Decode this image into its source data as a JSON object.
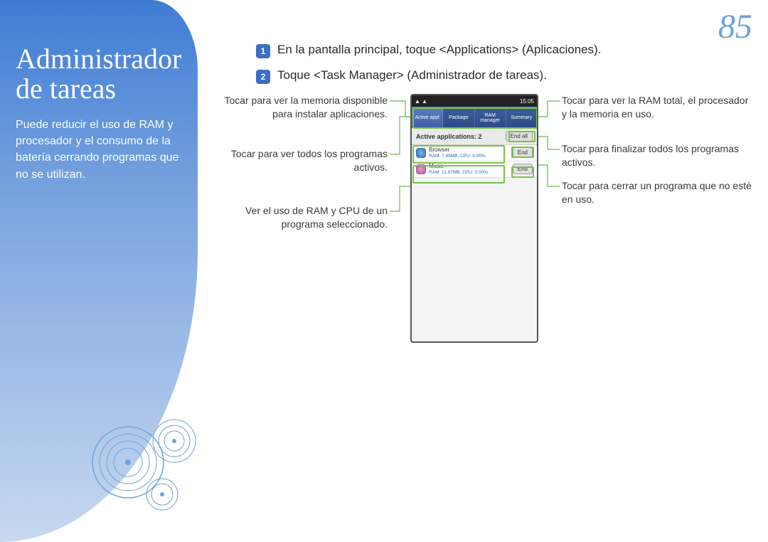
{
  "page_number": "85",
  "sidebar": {
    "title_line1": "Administrador",
    "title_line2": "de tareas",
    "description": "Puede reducir el uso de RAM y procesador y el consumo de la batería cerrando programas que no se utilizan."
  },
  "steps": [
    {
      "num": "1",
      "text": "En la pantalla principal, toque <Applications> (Aplicaciones)."
    },
    {
      "num": "2",
      "text": "Toque <Task Manager> (Administrador de tareas)."
    }
  ],
  "callouts_left": [
    "Tocar para ver la memoria disponible para instalar aplicaciones.",
    "Tocar para ver todos los programas activos.",
    "Ver el uso de RAM y CPU de un programa seleccionado."
  ],
  "callouts_right": [
    "Tocar para ver la RAM total, el procesador y la memoria en uso.",
    "Tocar para finalizar todos los programas activos.",
    "Tocar para cerrar un programa que no esté en uso."
  ],
  "phone": {
    "status_time": "15:05",
    "tabs": [
      "Active appl",
      "Package",
      "RAM manager",
      "Summary"
    ],
    "active_label": "Active applications: 2",
    "end_all": "End all",
    "end": "End",
    "apps": [
      {
        "name": "Browser",
        "meta": "RAM: 7.49MB, CPU: 0.00%",
        "color": "#3a6ec8"
      },
      {
        "name": "Music",
        "meta": "RAM: 11.97MB, CPU: 0.00%",
        "color": "#c95b9f"
      }
    ]
  }
}
